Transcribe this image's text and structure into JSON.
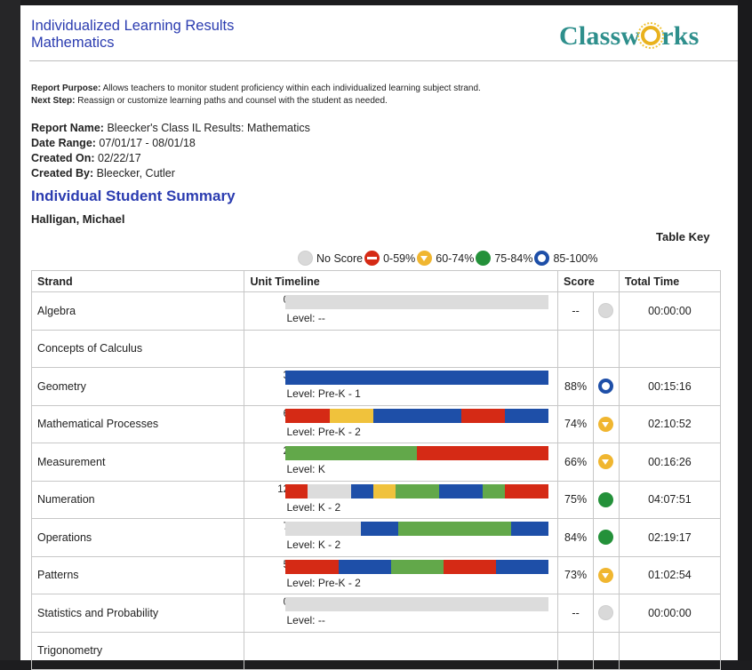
{
  "header": {
    "title_line1": "Individualized Learning Results",
    "title_line2": "Mathematics",
    "logo_text_left": "Classw",
    "logo_text_right": "rks"
  },
  "purpose": {
    "purpose_label": "Report Purpose:",
    "purpose_text": "Allows teachers to monitor student proficiency within each individualized learning subject strand.",
    "next_label": "Next Step:",
    "next_text": "Reassign or customize learning paths and counsel with the student as needed."
  },
  "meta": {
    "report_name_label": "Report Name:",
    "report_name": "Bleecker's Class IL Results: Mathematics",
    "date_range_label": "Date Range:",
    "date_range": "07/01/17 - 08/01/18",
    "created_on_label": "Created On:",
    "created_on": "02/22/17",
    "created_by_label": "Created By:",
    "created_by": "Bleecker, Cutler"
  },
  "section_title": "Individual Student Summary",
  "student_name": "Halligan, Michael",
  "table_key": {
    "title": "Table Key",
    "items": [
      {
        "label": "No Score",
        "icon": "gray-circle-icon"
      },
      {
        "label": "0-59%",
        "icon": "red-minus-icon"
      },
      {
        "label": "60-74%",
        "icon": "yellow-down-arrow-icon"
      },
      {
        "label": "75-84%",
        "icon": "green-circle-icon"
      },
      {
        "label": "85-100%",
        "icon": "blue-ring-icon"
      }
    ]
  },
  "table": {
    "headers": [
      "Strand",
      "Unit Timeline",
      "Score",
      "Total Time"
    ],
    "rows": [
      {
        "strand": "Algebra",
        "count": "0",
        "level": "Level: --",
        "score": "--",
        "icon": "gray",
        "time": "00:00:00",
        "segments": []
      },
      {
        "strand": "Concepts of Calculus",
        "count": "",
        "level": "",
        "score": "",
        "icon": "",
        "time": "",
        "segments": []
      },
      {
        "strand": "Geometry",
        "count": "3",
        "level": "Level: Pre-K - 1",
        "score": "88%",
        "icon": "blue",
        "time": "00:15:16",
        "segments": [
          "blu",
          "blu",
          "blu"
        ]
      },
      {
        "strand": "Mathematical Processes",
        "count": "6",
        "level": "Level: Pre-K - 2",
        "score": "74%",
        "icon": "yellow",
        "time": "02:10:52",
        "segments": [
          "red",
          "yel",
          "blu",
          "blu",
          "red",
          "blu"
        ]
      },
      {
        "strand": "Measurement",
        "count": "2",
        "level": "Level: K",
        "score": "66%",
        "icon": "yellow",
        "time": "00:16:26",
        "segments": [
          "grn",
          "red"
        ]
      },
      {
        "strand": "Numeration",
        "count": "12",
        "level": "Level: K - 2",
        "score": "75%",
        "icon": "green",
        "time": "04:07:51",
        "segments": [
          "red",
          "gry",
          "gry",
          "blu",
          "yel",
          "grn",
          "grn",
          "blu",
          "blu",
          "grn",
          "red",
          "red"
        ]
      },
      {
        "strand": "Operations",
        "count": "7",
        "level": "Level: K - 2",
        "score": "84%",
        "icon": "green",
        "time": "02:19:17",
        "segments": [
          "gry",
          "gry",
          "blu",
          "grn",
          "grn",
          "grn",
          "blu"
        ]
      },
      {
        "strand": "Patterns",
        "count": "5",
        "level": "Level: Pre-K - 2",
        "score": "73%",
        "icon": "yellow",
        "time": "01:02:54",
        "segments": [
          "red",
          "blu",
          "grn",
          "red",
          "blu"
        ]
      },
      {
        "strand": "Statistics and Probability",
        "count": "0",
        "level": "Level: --",
        "score": "--",
        "icon": "gray",
        "time": "00:00:00",
        "segments": []
      },
      {
        "strand": "Trigonometry",
        "count": "",
        "level": "",
        "score": "",
        "icon": "",
        "time": "",
        "segments": []
      }
    ]
  },
  "colors": {
    "red": "#d52a15",
    "yellow": "#f0c23c",
    "blue": "#1e4fa8",
    "green": "#62a84a",
    "gray": "#dcdcdc",
    "title_blue": "#2b3cb0",
    "logo_teal": "#2e8f8c"
  }
}
